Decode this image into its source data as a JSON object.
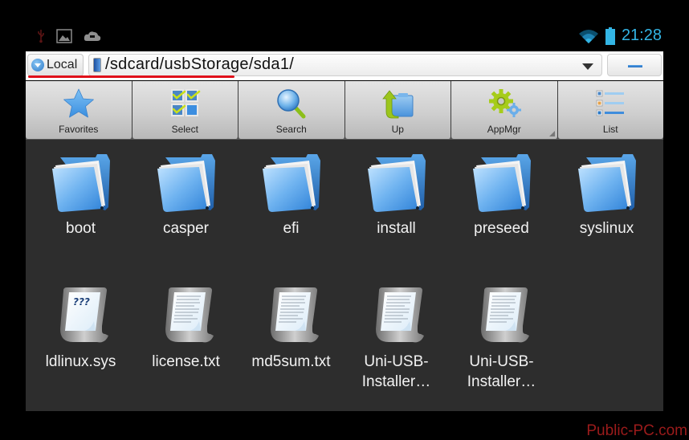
{
  "status_bar": {
    "left_icons": [
      "usb-icon",
      "image-icon",
      "cloud-icon"
    ],
    "right_icons": [
      "wifi-icon",
      "battery-icon"
    ],
    "time": "21:28",
    "accent": "#33b5e5"
  },
  "path_bar": {
    "location_button": "Local",
    "path": "/sdcard/usbStorage/sda1/",
    "path_icon": "phone-storage-icon",
    "underline_color": "#e0101a"
  },
  "toolbar": {
    "buttons": [
      {
        "label": "Favorites",
        "icon": "star-icon"
      },
      {
        "label": "Select",
        "icon": "multi-select-icon"
      },
      {
        "label": "Search",
        "icon": "magnifier-icon"
      },
      {
        "label": "Up",
        "icon": "folder-up-icon"
      },
      {
        "label": "AppMgr",
        "icon": "gears-icon"
      },
      {
        "label": "List",
        "icon": "list-view-icon"
      }
    ]
  },
  "files": [
    {
      "name": "boot",
      "type": "folder"
    },
    {
      "name": "casper",
      "type": "folder"
    },
    {
      "name": "efi",
      "type": "folder"
    },
    {
      "name": "install",
      "type": "folder"
    },
    {
      "name": "preseed",
      "type": "folder"
    },
    {
      "name": "syslinux",
      "type": "folder"
    },
    {
      "name": "ldlinux.sys",
      "type": "unknown"
    },
    {
      "name": "license.txt",
      "type": "text"
    },
    {
      "name": "md5sum.txt",
      "type": "text"
    },
    {
      "name": "Uni-USB-Installer…",
      "type": "text"
    },
    {
      "name": "Uni-USB-Installer…",
      "type": "text"
    }
  ],
  "watermark": "Public-PC.com"
}
